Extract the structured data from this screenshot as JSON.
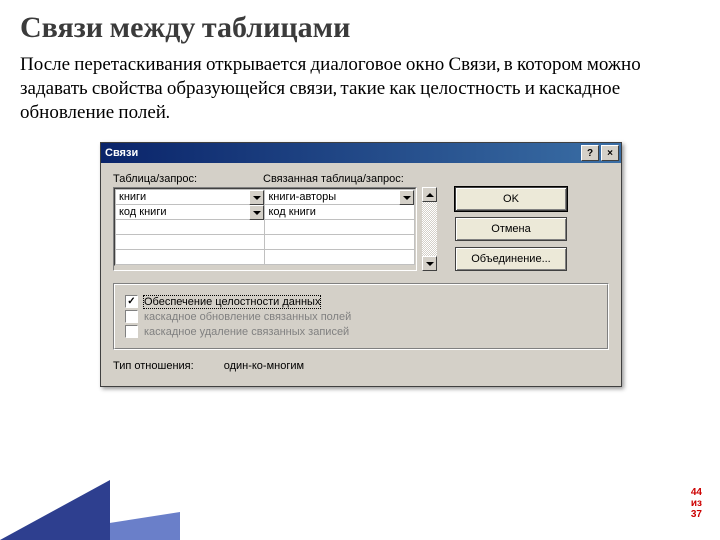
{
  "heading": "Связи между таблицами",
  "paragraph": "После перетаскивания открывается диалоговое окно Связи, в котором можно задавать свойства образующейся связи, такие как целостность и каскадное обновление полей.",
  "dialog": {
    "title": "Связи",
    "help_symbol": "?",
    "close_symbol": "×",
    "labels": {
      "table": "Таблица/запрос:",
      "related_table": "Связанная таблица/запрос:"
    },
    "grid": {
      "left": [
        "книги",
        "код книги",
        "",
        "",
        ""
      ],
      "right": [
        "книги-авторы",
        "код книги",
        "",
        "",
        ""
      ]
    },
    "buttons": {
      "ok": "OK",
      "cancel": "Отмена",
      "join": "Объединение..."
    },
    "checks": {
      "integrity": "Обеспечение целостности данных",
      "cascade_update": "каскадное обновление связанных полей",
      "cascade_delete": "каскадное удаление связанных записей"
    },
    "typelabel": "Тип отношения:",
    "typevalue": "один-ко-многим"
  },
  "page": {
    "num": "44",
    "of_word": "из",
    "total": "37"
  }
}
